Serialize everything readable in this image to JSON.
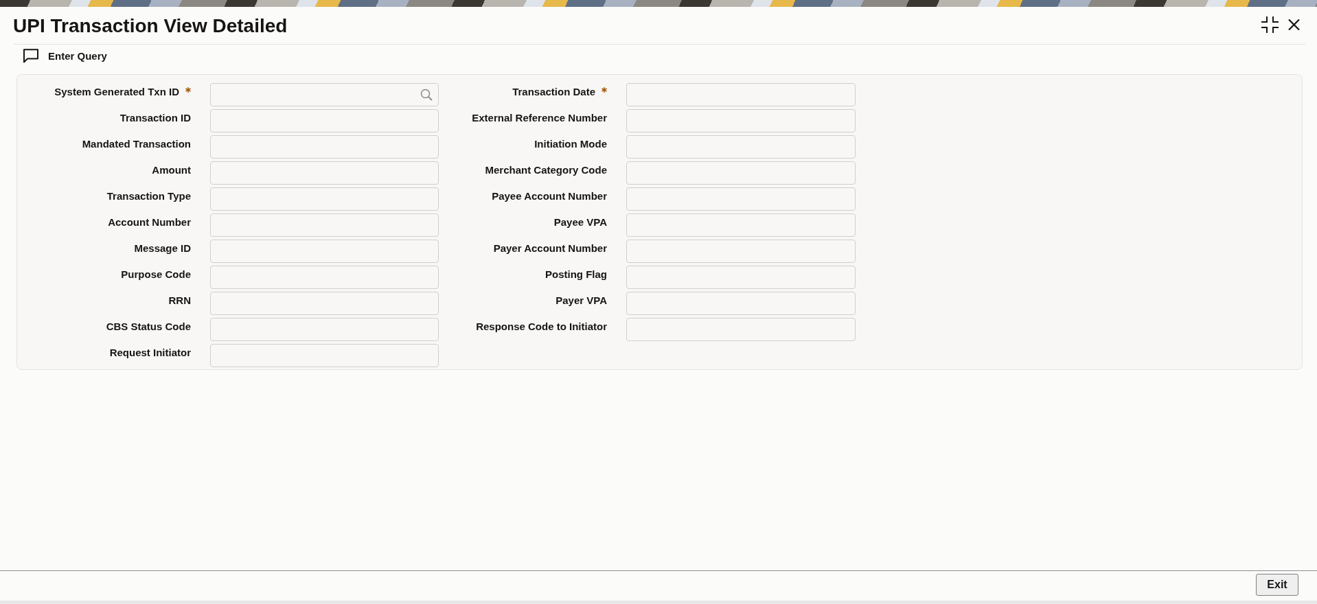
{
  "window": {
    "title": "UPI Transaction View Detailed"
  },
  "toolbar": {
    "buttons": [
      {
        "label": "Enter Query"
      }
    ]
  },
  "form": {
    "columns": [
      {
        "fields": [
          {
            "label": "System Generated Txn ID",
            "required": true,
            "lookup": true
          },
          {
            "label": "Transaction ID",
            "required": false,
            "lookup": false
          },
          {
            "label": "Mandated Transaction",
            "required": false,
            "lookup": false
          },
          {
            "label": "Amount",
            "required": false,
            "lookup": false
          },
          {
            "label": "Transaction Type",
            "required": false,
            "lookup": false
          },
          {
            "label": "Account Number",
            "required": false,
            "lookup": false
          },
          {
            "label": "Message ID",
            "required": false,
            "lookup": false
          },
          {
            "label": "Purpose Code",
            "required": false,
            "lookup": false
          },
          {
            "label": "RRN",
            "required": false,
            "lookup": false
          },
          {
            "label": "CBS Status Code",
            "required": false,
            "lookup": false
          },
          {
            "label": "Request Initiator",
            "required": false,
            "lookup": false
          }
        ]
      },
      {
        "fields": [
          {
            "label": "Transaction Date",
            "required": true,
            "lookup": false
          },
          {
            "label": "External Reference Number",
            "required": false,
            "lookup": false
          },
          {
            "label": "Initiation Mode",
            "required": false,
            "lookup": false
          },
          {
            "label": "Merchant Category Code",
            "required": false,
            "lookup": false
          },
          {
            "label": "Payee Account Number",
            "required": false,
            "lookup": false
          },
          {
            "label": "Payee VPA",
            "required": false,
            "lookup": false
          },
          {
            "label": "Payer Account Number",
            "required": false,
            "lookup": false
          },
          {
            "label": "Posting Flag",
            "required": false,
            "lookup": false
          },
          {
            "label": "Payer VPA",
            "required": false,
            "lookup": false
          },
          {
            "label": "Response Code to Initiator",
            "required": false,
            "lookup": false
          }
        ]
      }
    ]
  },
  "footer": {
    "buttons": [
      "Exit"
    ]
  }
}
